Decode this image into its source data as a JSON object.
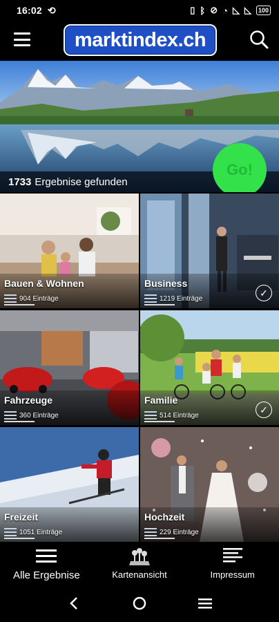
{
  "status_bar": {
    "time": "16:02",
    "battery": "100"
  },
  "header": {
    "logo_text": "marktindex.ch",
    "menu_icon": "hamburger-menu-icon",
    "search_icon": "search-icon"
  },
  "hero": {
    "results_count": "1733",
    "results_label": "Ergebnise gefunden",
    "go_label": "Go!"
  },
  "categories": [
    {
      "title": "Bauen & Wohnen",
      "count": "904 Einträge",
      "selected": false
    },
    {
      "title": "Business",
      "count": "1219 Einträge",
      "selected": true
    },
    {
      "title": "Fahrzeuge",
      "count": "360 Einträge",
      "selected": false
    },
    {
      "title": "Familie",
      "count": "514 Einträge",
      "selected": true
    },
    {
      "title": "Freizeit",
      "count": "1051 Einträge",
      "selected": false
    },
    {
      "title": "Hochzeit",
      "count": "229 Einträge",
      "selected": false
    }
  ],
  "tabbar": {
    "all_results": "Alle Ergebnise",
    "map_view": "Kartenansicht",
    "imprint": "Impressum"
  },
  "colors": {
    "logo_blue": "#1f4fc4",
    "go_green": "#33e24a",
    "background": "#000000"
  }
}
